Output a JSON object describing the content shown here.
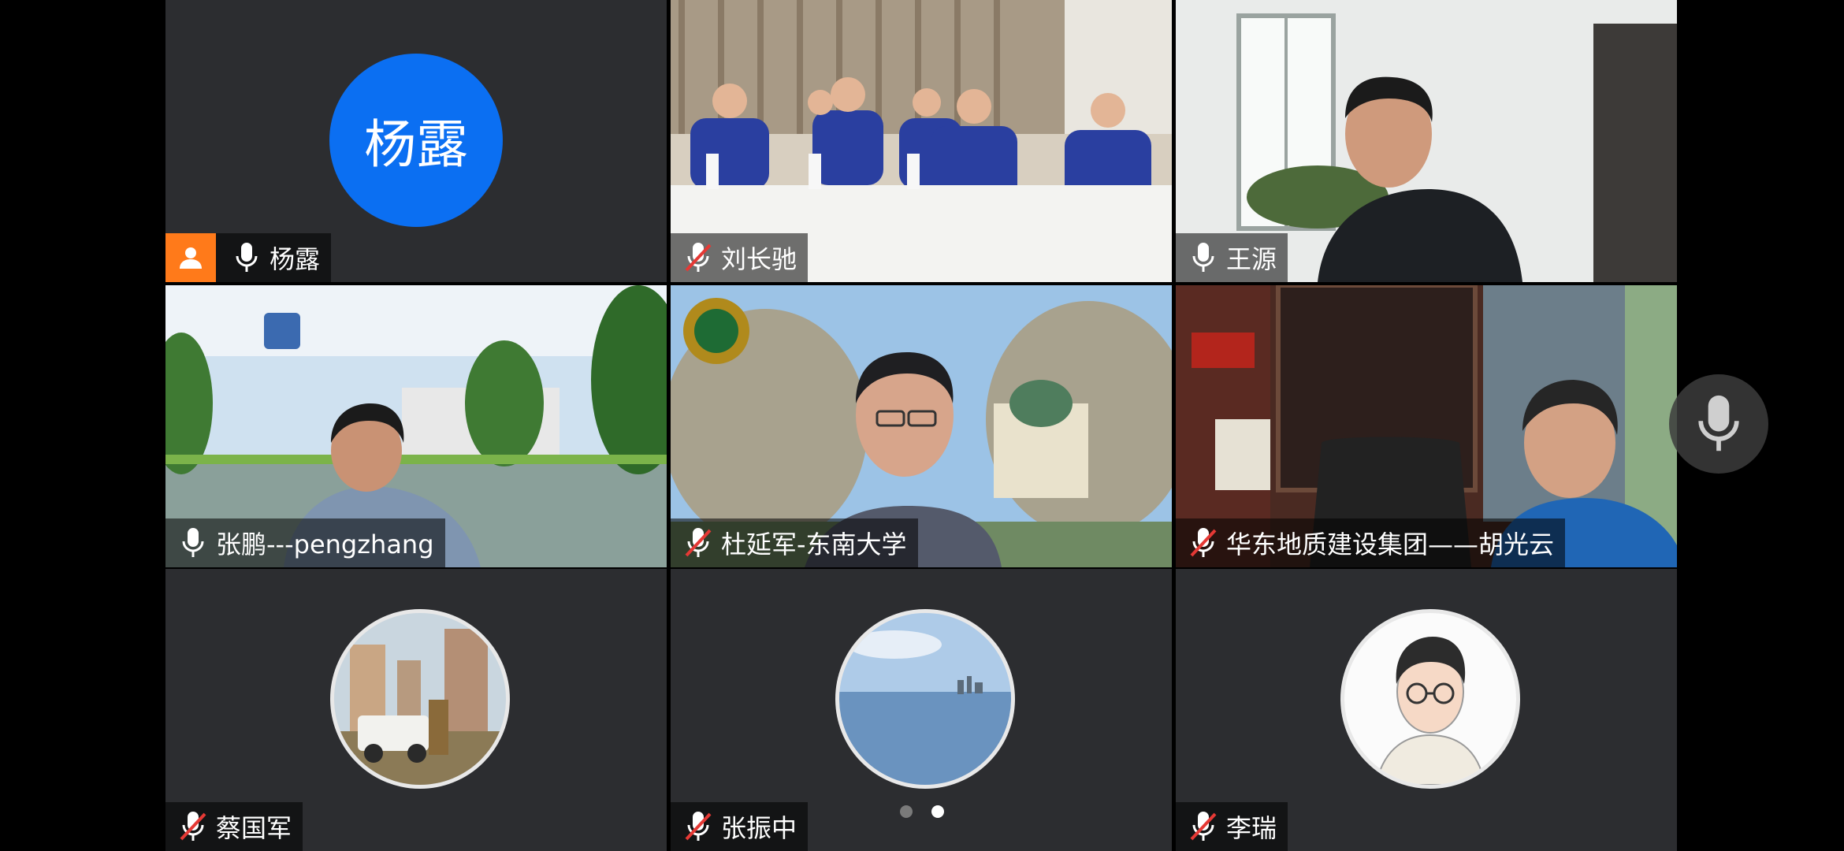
{
  "tiles": [
    {
      "name": "杨露",
      "avatar_text": "杨露",
      "host": true,
      "mic": "on"
    },
    {
      "name": "刘长驰",
      "mic": "muted"
    },
    {
      "name": "王源",
      "mic": "on",
      "active_speaker": true
    },
    {
      "name": "张鹏---pengzhang",
      "mic": "on"
    },
    {
      "name": "杜延军-东南大学",
      "mic": "muted"
    },
    {
      "name": "华东地质建设集团——胡光云",
      "mic": "muted"
    },
    {
      "name": "蔡国军",
      "mic": "muted"
    },
    {
      "name": "张振中",
      "mic": "muted"
    },
    {
      "name": "李瑞",
      "mic": "muted"
    }
  ],
  "pager": {
    "pages": 2,
    "current": 2
  },
  "colors": {
    "tile_bg": "#2c2d30",
    "active_border": "#25c46a",
    "host_badge": "#ff7a1a",
    "avatar_blue": "#0b6ff2",
    "muted_red": "#e53935"
  }
}
